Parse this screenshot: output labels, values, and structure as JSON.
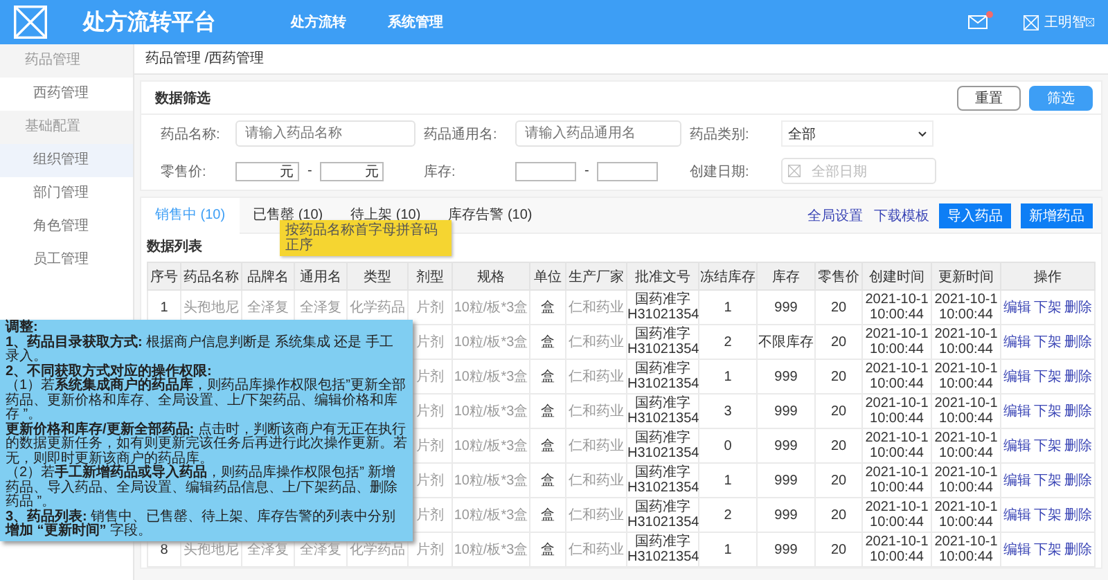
{
  "header": {
    "title": "处方流转平台",
    "nav": [
      {
        "label": "处方流转"
      },
      {
        "label": "系统管理"
      }
    ],
    "has_unread": true,
    "user": "王明智"
  },
  "sidebar": {
    "groups": [
      {
        "label": "药品管理",
        "items": [
          {
            "label": "西药管理",
            "selected": false
          }
        ]
      },
      {
        "label": "基础配置",
        "items": [
          {
            "label": "组织管理",
            "selected": true
          },
          {
            "label": "部门管理",
            "selected": false
          },
          {
            "label": "角色管理",
            "selected": false
          },
          {
            "label": "员工管理",
            "selected": false
          }
        ]
      }
    ]
  },
  "breadcrumb": "药品管理 /西药管理",
  "filter": {
    "title": "数据筛选",
    "buttons": [
      {
        "label": "重置",
        "kind": "outline"
      },
      {
        "label": "筛选",
        "kind": "primary"
      }
    ],
    "name": {
      "label": "药品名称:",
      "placeholder": "请输入药品名称"
    },
    "generic": {
      "label": "药品通用名:",
      "placeholder": "请输入药品通用名"
    },
    "category": {
      "label": "药品类别:",
      "value": "全部"
    },
    "price": {
      "label": "零售价:",
      "min_unit": "元",
      "max_unit": "元",
      "separator": "-"
    },
    "stock": {
      "label": "库存:",
      "separator": "-"
    },
    "date": {
      "label": "创建日期:",
      "placeholder": "全部日期"
    }
  },
  "tabs": [
    {
      "label": "销售中 (10)",
      "selected": true
    },
    {
      "label": "已售罄 (10)",
      "selected": false
    },
    {
      "label": "待上架 (10)",
      "selected": false
    },
    {
      "label": "库存告警 (10)",
      "selected": false
    }
  ],
  "links": [
    "全局设置",
    "下载模板"
  ],
  "actions": [
    "导入药品",
    "新增药品"
  ],
  "list_title": "数据列表",
  "tooltip": "按药品名称首字母拼音码正序",
  "table": {
    "columns": [
      "序号",
      "药品名称",
      "品牌名",
      "通用名",
      "类型",
      "剂型",
      "规格",
      "单位",
      "生产厂家",
      "批准文号",
      "冻结库存",
      "库存",
      "零售价",
      "创建时间",
      "更新时间",
      "操作"
    ],
    "rows": [
      {
        "seq": "1",
        "name": "头孢地尼",
        "brand": "全泽复",
        "generic": "全泽复",
        "type": "化学药品",
        "form": "片剂",
        "spec": "10粒/板*3盒",
        "unit": "盒",
        "maker": "仁和药业",
        "approval": "国药准字 H31021354",
        "frozen": "1",
        "stock": "999",
        "price": "20",
        "created": "2021-10-1 10:00:44",
        "updated": "2021-10-1 10:00:44",
        "ops": [
          "编辑",
          "下架",
          "删除"
        ]
      },
      {
        "form": "片剂",
        "spec": "10粒/板*3盒",
        "unit": "盒",
        "maker": "仁和药业",
        "approval": "国药准字 H31021354",
        "frozen": "2",
        "stock": "不限库存",
        "price": "20",
        "created": "2021-10-1 10:00:44",
        "updated": "2021-10-1 10:00:44",
        "ops": [
          "编辑",
          "下架",
          "删除"
        ]
      },
      {
        "form": "片剂",
        "spec": "10粒/板*3盒",
        "unit": "盒",
        "maker": "仁和药业",
        "approval": "国药准字 H31021354",
        "frozen": "1",
        "stock": "999",
        "price": "20",
        "created": "2021-10-1 10:00:44",
        "updated": "2021-10-1 10:00:44",
        "ops": [
          "编辑",
          "下架",
          "删除"
        ]
      },
      {
        "form": "片剂",
        "spec": "10粒/板*3盒",
        "unit": "盒",
        "maker": "仁和药业",
        "approval": "国药准字 H31021354",
        "frozen": "3",
        "stock": "999",
        "price": "20",
        "created": "2021-10-1 10:00:44",
        "updated": "2021-10-1 10:00:44",
        "ops": [
          "编辑",
          "下架",
          "删除"
        ]
      },
      {
        "form": "片剂",
        "spec": "10粒/板*3盒",
        "unit": "盒",
        "maker": "仁和药业",
        "approval": "国药准字 H31021354",
        "frozen": "0",
        "stock": "999",
        "price": "20",
        "created": "2021-10-1 10:00:44",
        "updated": "2021-10-1 10:00:44",
        "ops": [
          "编辑",
          "下架",
          "删除"
        ]
      },
      {
        "form": "片剂",
        "spec": "10粒/板*3盒",
        "unit": "盒",
        "maker": "仁和药业",
        "approval": "国药准字 H31021354",
        "frozen": "1",
        "stock": "999",
        "price": "20",
        "created": "2021-10-1 10:00:44",
        "updated": "2021-10-1 10:00:44",
        "ops": [
          "编辑",
          "下架",
          "删除"
        ]
      },
      {
        "form": "片剂",
        "spec": "10粒/板*3盒",
        "unit": "盒",
        "maker": "仁和药业",
        "approval": "国药准字 H31021354",
        "frozen": "2",
        "stock": "999",
        "price": "20",
        "created": "2021-10-1 10:00:44",
        "updated": "2021-10-1 10:00:44",
        "ops": [
          "编辑",
          "下架",
          "删除"
        ]
      },
      {
        "seq": "8",
        "name": "头孢地尼",
        "brand": "全泽复",
        "generic": "全泽复",
        "type": "化学药品",
        "form": "片剂",
        "spec": "10粒/板*3盒",
        "unit": "盒",
        "maker": "仁和药业",
        "approval": "国药准字 H31021354",
        "frozen": "1",
        "stock": "999",
        "price": "20",
        "created": "2021-10-1 10:00:44",
        "updated": "2021-10-1 10:00:44",
        "ops": [
          "编辑",
          "下架",
          "删除"
        ]
      }
    ]
  },
  "note": [
    "**调整:**",
    "**1、药品目录获取方式:** 根据商户信息判断是 系统集成 还是 手工录入。",
    "**2、不同获取方式对应的操作权限:**",
    "（1）若**系统集成商户的药品库**，则药品库操作权限包括”更新全部药品、更新价格和库存、全局设置、上/下架药品、编辑价格和库存 ”。",
    "**更新价格和库存/更新全部药品:** 点击时，判断该商户有无正在执行的数据更新任务，如有则更新完该任务后再进行此次操作更新。若无，则即时更新该商户的药品库。",
    "（2）若**手工新增药品或导入药品**，则药品库操作权限包括” 新增药品、导入药品、全局设置、编辑药品信息、上/下架药品、删除药品 ”。",
    "**3、药品列表:** 销售中、已售罄、待上架、库存告警的列表中分别**增加 “更新时间”** 字段。"
  ]
}
